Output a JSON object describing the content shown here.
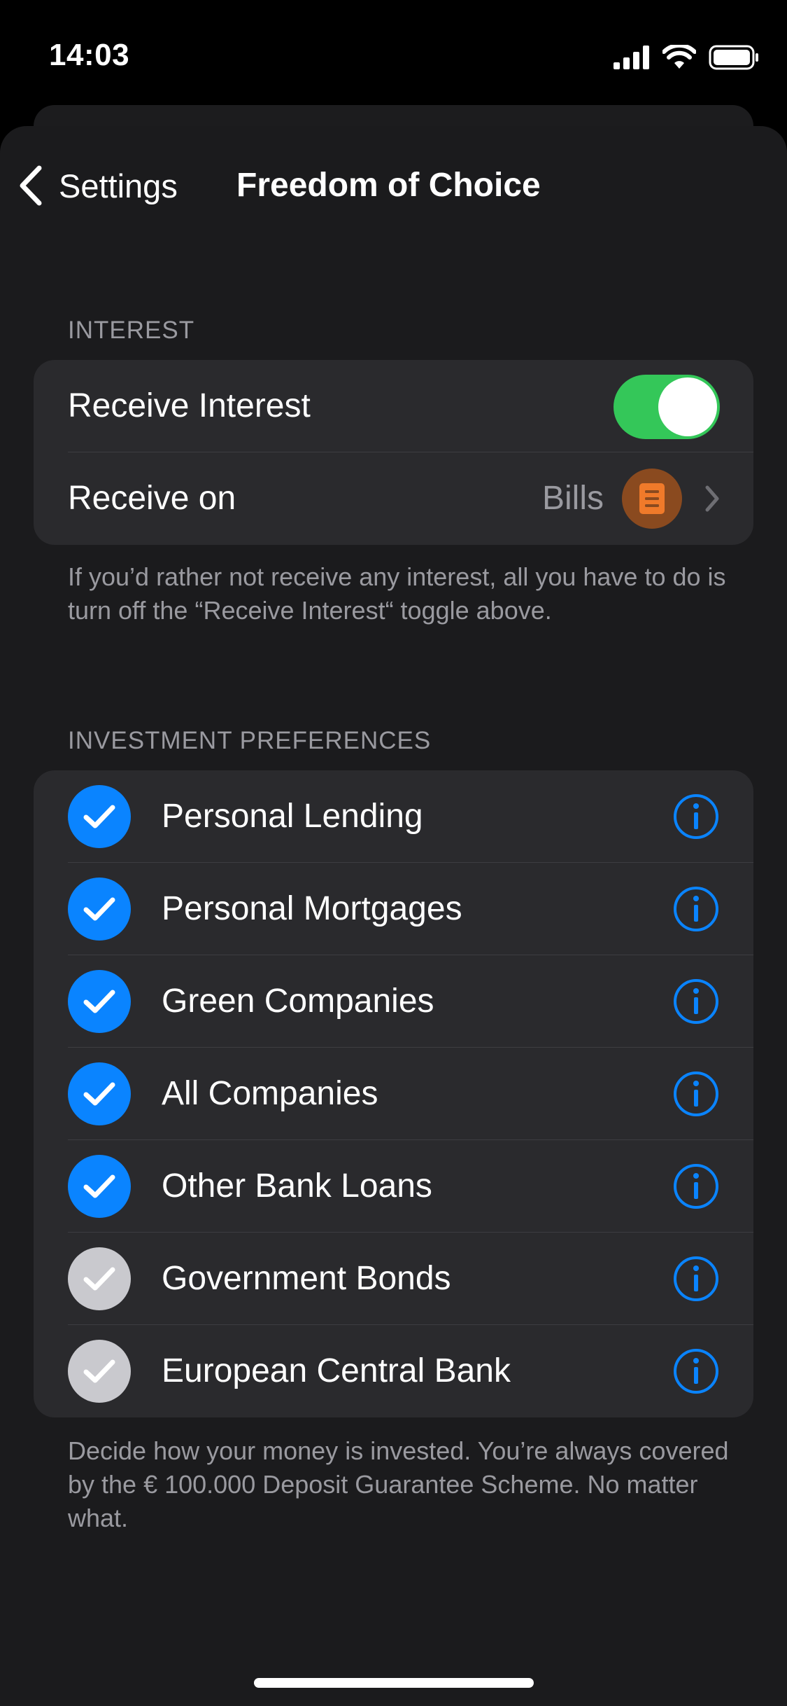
{
  "status": {
    "time": "14:03"
  },
  "nav": {
    "back_label": "Settings",
    "title": "Freedom of Choice"
  },
  "interest": {
    "header": "INTEREST",
    "receive_interest_label": "Receive Interest",
    "receive_interest_on": true,
    "receive_on_label": "Receive on",
    "receive_on_value": "Bills",
    "footer": "If you’d rather not receive any interest, all you have to do is turn off the “Receive Interest“ toggle above."
  },
  "preferences": {
    "header": "INVESTMENT PREFERENCES",
    "items": [
      {
        "label": "Personal Lending",
        "checked": true
      },
      {
        "label": "Personal Mortgages",
        "checked": true
      },
      {
        "label": "Green Companies",
        "checked": true
      },
      {
        "label": "All Companies",
        "checked": true
      },
      {
        "label": "Other Bank Loans",
        "checked": true
      },
      {
        "label": "Government Bonds",
        "checked": false
      },
      {
        "label": "European Central Bank",
        "checked": false
      }
    ],
    "footer": "Decide how your money is invested. You’re always covered by the € 100.000 Deposit Guarantee Scheme. No matter what."
  },
  "colors": {
    "accent": "#0a84ff",
    "toggle_on": "#34c759",
    "badge": "#f07a2a"
  },
  "icons": {
    "back": "chevron-left-icon",
    "disclosure": "chevron-right-icon",
    "info": "info-circle-icon",
    "check": "checkmark-icon",
    "account": "document-icon"
  }
}
